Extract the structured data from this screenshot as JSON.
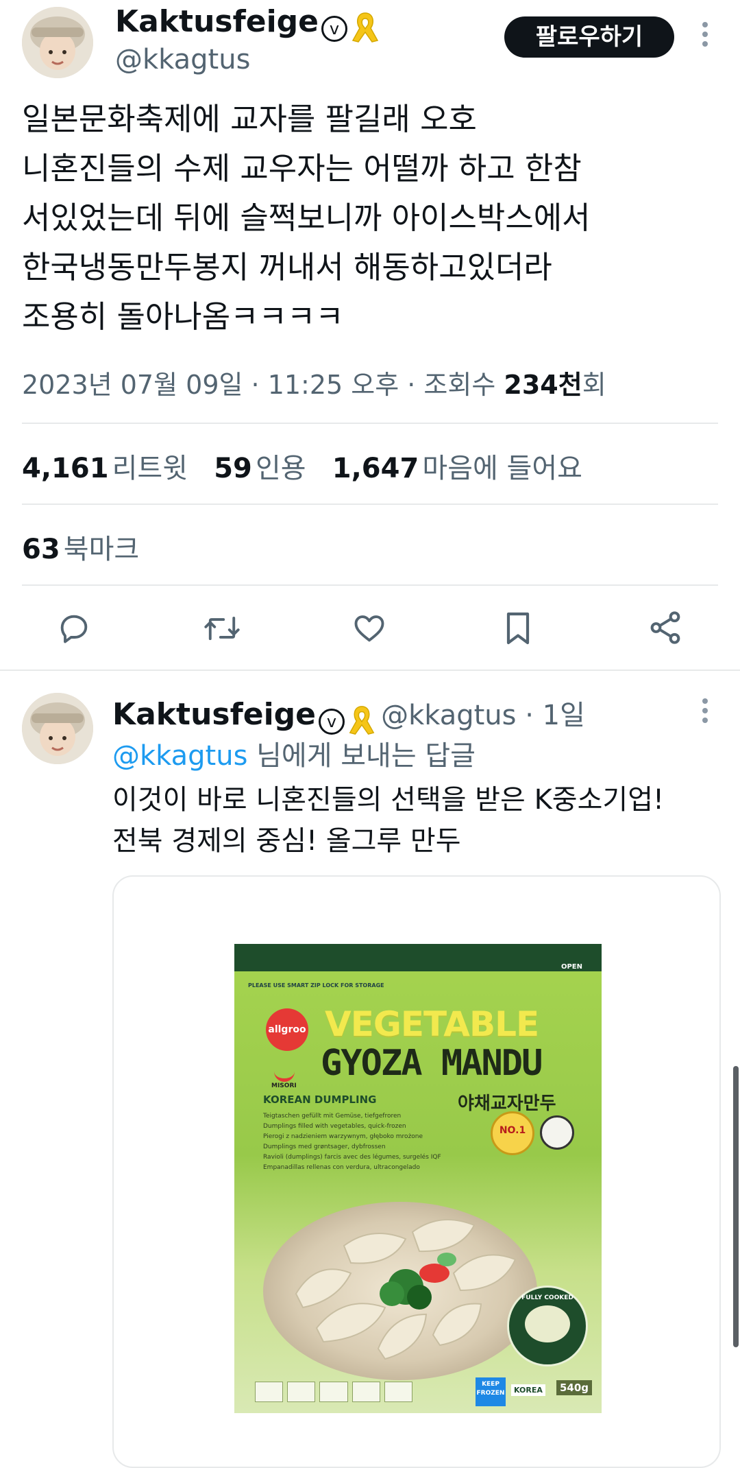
{
  "main_tweet": {
    "display_name": "Kaktusfeige",
    "verified_glyph": "v",
    "handle": "@kkagtus",
    "follow_label": "팔로우하기",
    "text_lines": [
      "일본문화축제에 교자를 팔길래 오호",
      "니혼진들의 수제 교우자는 어떨까 하고 한참",
      "서있었는데 뒤에 슬쩍보니까 아이스박스에서",
      "한국냉동만두봉지 꺼내서 해동하고있더라",
      "조용히 돌아나옴ㅋㅋㅋㅋ"
    ],
    "meta": {
      "date": "2023년 07월 09일 · 11:25 오후 · 조회수 ",
      "views_num": "234천",
      "views_suffix": "회"
    },
    "stats": {
      "retweets_num": "4,161",
      "retweets_label": "리트윗",
      "quotes_num": "59",
      "quotes_label": "인용",
      "likes_num": "1,647",
      "likes_label": "마음에 들어요",
      "bookmarks_num": "63",
      "bookmarks_label": "북마크"
    },
    "actions": [
      "reply-icon",
      "retweet-icon",
      "like-icon",
      "bookmark-icon",
      "share-icon"
    ]
  },
  "reply_tweet": {
    "display_name": "Kaktusfeige",
    "verified_glyph": "v",
    "handle": "@kkagtus",
    "time": " · 1일",
    "replying_to_handle": "@kkagtus",
    "replying_to_suffix": " 님에게 보내는 답글",
    "text_lines": [
      "이것이 바로 니혼진들의 선택을 받은 K중소기업!",
      "전북 경제의 중심! 올그루 만두"
    ]
  },
  "product": {
    "brand": "allgroo",
    "sub_brand": "MISORI",
    "title_line1": "VEGETABLE",
    "title_line2": "GYOZA MANDU",
    "korean_name": "야채교자만두",
    "category": "KOREAN DUMPLING",
    "descriptions": [
      "Teigtaschen gefüllt mit Gemüse, tiefgefroren",
      "Dumplings filled with vegetables, quick-frozen",
      "Pierogi z nadzieniem warzywnym, głęboko mrożone",
      "Dumplings med grøntsager, dybfrossen",
      "Ravioli (dumplings) farcis avec des légumes, surgelés IQF",
      "Empanadillas rellenas con verdura, ultracongelado"
    ],
    "top_note": "PLEASE USE SMART ZIP LOCK FOR STORAGE",
    "open_label": "OPEN",
    "no1": "NO.1",
    "fully_cooked": "FULLY COOKED",
    "keep_frozen": "KEEP FROZEN",
    "korea": "KOREA",
    "weight": "540g",
    "colors": {
      "green": "#8bc34a",
      "dark_green": "#1e4d2b",
      "title_yellow": "#f2e94e"
    }
  },
  "colors": {
    "text": "#0f1419",
    "secondary": "#536471",
    "accent": "#1d9bf0",
    "divider": "#e7e9ea",
    "ribbon": "#f5c518"
  }
}
